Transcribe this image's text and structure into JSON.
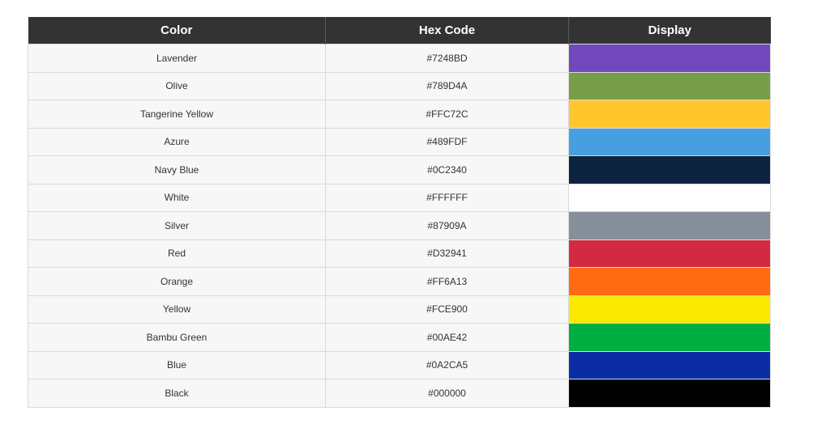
{
  "table": {
    "headers": [
      "Color",
      "Hex Code",
      "Display"
    ],
    "rows": [
      {
        "name": "Lavender",
        "hex": "#7248BD",
        "display": "#7248BD"
      },
      {
        "name": "Olive",
        "hex": "#789D4A",
        "display": "#789D4A"
      },
      {
        "name": "Tangerine Yellow",
        "hex": "#FFC72C",
        "display": "#FFC72C"
      },
      {
        "name": "Azure",
        "hex": "#489FDF",
        "display": "#489FDF"
      },
      {
        "name": "Navy Blue",
        "hex": "#0C2340",
        "display": "#0C2340"
      },
      {
        "name": "White",
        "hex": "#FFFFFF",
        "display": "#FFFFFF"
      },
      {
        "name": "Silver",
        "hex": "#87909A",
        "display": "#87909A"
      },
      {
        "name": "Red",
        "hex": "#D32941",
        "display": "#D32941"
      },
      {
        "name": "Orange",
        "hex": "#FF6A13",
        "display": "#FF6A13"
      },
      {
        "name": "Yellow",
        "hex": "#FCE900",
        "display": "#FCE900"
      },
      {
        "name": "Bambu Green",
        "hex": "#00AE42",
        "display": "#00AE42"
      },
      {
        "name": "Blue",
        "hex": "#0A2CA5",
        "display": "#0A2CA5"
      },
      {
        "name": "Black",
        "hex": "#000000",
        "display": "#000000"
      }
    ]
  }
}
